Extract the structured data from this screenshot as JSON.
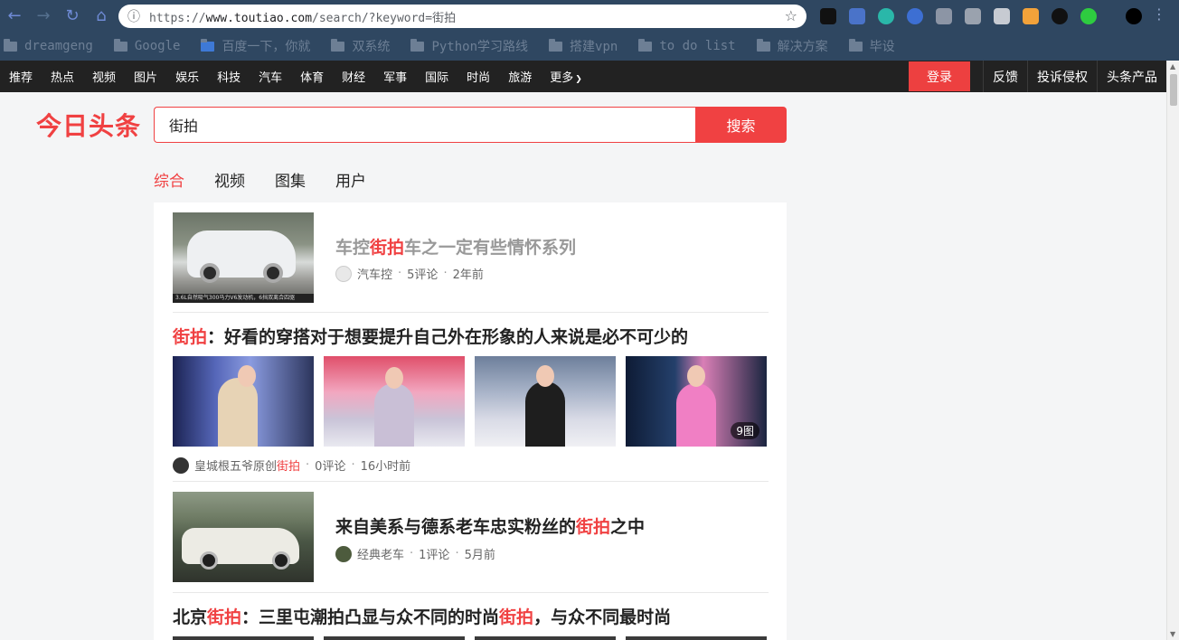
{
  "browser": {
    "url_scheme": "https://",
    "url_host": "www.toutiao.com",
    "url_path": "/search/?keyword=街拍",
    "bookmarks": [
      "dreamgeng",
      "Google",
      "百度一下，你就",
      "双系统",
      "Python学习路线",
      "搭建vpn",
      "to do list",
      "解决方案",
      "毕设"
    ]
  },
  "site_nav": {
    "categories": [
      "推荐",
      "热点",
      "视频",
      "图片",
      "娱乐",
      "科技",
      "汽车",
      "体育",
      "财经",
      "军事",
      "国际",
      "时尚",
      "旅游",
      "更多"
    ],
    "login": "登录",
    "right_links": [
      "反馈",
      "投诉侵权",
      "头条产品"
    ]
  },
  "header": {
    "logo": "今日头条",
    "search_value": "街拍",
    "search_button": "搜索"
  },
  "tabs": [
    "综合",
    "视频",
    "图集",
    "用户"
  ],
  "results": [
    {
      "title_parts": [
        "车控",
        "街拍",
        "车之一定有些情怀系列"
      ],
      "thumb_caption": "3.6L自然吸气300马力V6发动机，6挡双离合四驱",
      "source": "汽车控",
      "comments": "5评论",
      "time": "2年前"
    },
    {
      "title_parts": [
        "街拍",
        "：好看的穿搭对于想要提升自己外在形象的人来说是必不可少的"
      ],
      "image_count": "9图",
      "source_parts": [
        "皇城根五爷原创",
        "街拍"
      ],
      "comments": "0评论",
      "time": "16小时前"
    },
    {
      "title_parts": [
        "来自美系与德系老车忠实粉丝的",
        "街拍",
        "之中"
      ],
      "source": "经典老车",
      "comments": "1评论",
      "time": "5月前"
    },
    {
      "title_parts": [
        "北京",
        "街拍",
        "：三里屯潮拍凸显与众不同的时尚",
        "街拍",
        "，与众不同最时尚"
      ]
    }
  ],
  "colors": {
    "accent": "#f04142",
    "chrome": "#2f4761",
    "nav": "#222222"
  }
}
